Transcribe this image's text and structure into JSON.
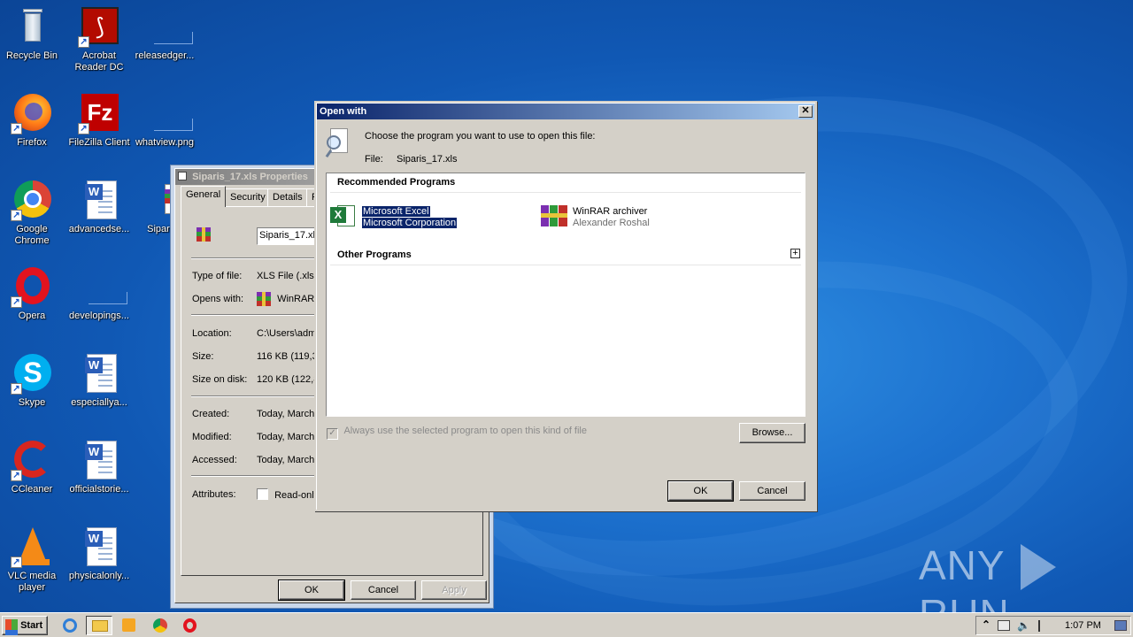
{
  "desktop": {
    "icons": [
      {
        "label": "Recycle Bin"
      },
      {
        "label": "Acrobat\nReader DC"
      },
      {
        "label": "releasedger..."
      },
      {
        "label": "Firefox"
      },
      {
        "label": "FileZilla Client"
      },
      {
        "label": "whatview.png"
      },
      {
        "label": "Google\nChrome"
      },
      {
        "label": "advancedse..."
      },
      {
        "label": "Siparis_"
      },
      {
        "label": "Opera"
      },
      {
        "label": "developings..."
      },
      {
        "label": "Skype"
      },
      {
        "label": "especiallya..."
      },
      {
        "label": "CCleaner"
      },
      {
        "label": "officialstorie..."
      },
      {
        "label": "VLC media\nplayer"
      },
      {
        "label": "physicalonly..."
      }
    ]
  },
  "properties_dialog": {
    "title": "Siparis_17.xls Properties",
    "tabs": [
      {
        "label": "General"
      },
      {
        "label": "Security"
      },
      {
        "label": "Details"
      },
      {
        "label": "P"
      }
    ],
    "filename": "Siparis_17.xls",
    "rows": {
      "type_label": "Type of file:",
      "type_value": "XLS File (.xls)",
      "opens_label": "Opens with:",
      "opens_value": "WinRAR",
      "location_label": "Location:",
      "location_value": "C:\\Users\\adm",
      "size_label": "Size:",
      "size_value": "116 KB (119,3",
      "disk_label": "Size on disk:",
      "disk_value": "120 KB (122,8",
      "created_label": "Created:",
      "created_value": "Today, March",
      "modified_label": "Modified:",
      "modified_value": "Today, March",
      "accessed_label": "Accessed:",
      "accessed_value": "Today, March",
      "attributes_label": "Attributes:",
      "readonly_label": "Read-only"
    },
    "ok_label": "OK",
    "cancel_label": "Cancel",
    "apply_label": "Apply"
  },
  "open_with": {
    "title": "Open with",
    "close_glyph": "✕",
    "instruction": "Choose the program you want to use to open this file:",
    "file_label": "File:",
    "file_value": "Siparis_17.xls",
    "recommended_header": "Recommended Programs",
    "programs": [
      {
        "name": "Microsoft Excel",
        "publisher": "Microsoft Corporation",
        "selected": true
      },
      {
        "name": "WinRAR archiver",
        "publisher": "Alexander Roshal",
        "selected": false
      }
    ],
    "other_header": "Other Programs",
    "expand_glyph": "+",
    "always_use_label": "Always use the selected program to open this kind of file",
    "browse_label": "Browse...",
    "ok_label": "OK",
    "cancel_label": "Cancel"
  },
  "taskbar": {
    "start_label": "Start",
    "clock": "1:07 PM",
    "tray_arrow": "⌃"
  },
  "watermark": {
    "left": "ANY",
    "right": "RUN"
  },
  "colors": {
    "desktop": "#1d72cf",
    "dialog_face": "#d4d0c8",
    "selection": "#0a246a",
    "title_start": "#0a246a",
    "title_end": "#a6caf0"
  }
}
